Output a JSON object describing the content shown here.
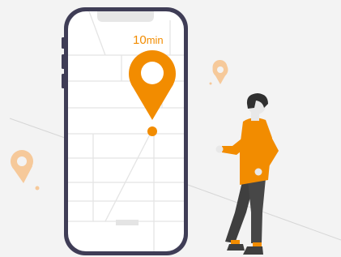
{
  "illustration": {
    "eta_value": "10",
    "eta_unit": "min",
    "icons": [
      "phone-icon",
      "location-pin-icon",
      "person-icon"
    ],
    "colors": {
      "accent": "#f28c00",
      "accent_light": "#f6c99a",
      "phone_frame": "#3f3d56",
      "map_lines": "#e4e4e4",
      "background": "#f3f3f3"
    }
  }
}
